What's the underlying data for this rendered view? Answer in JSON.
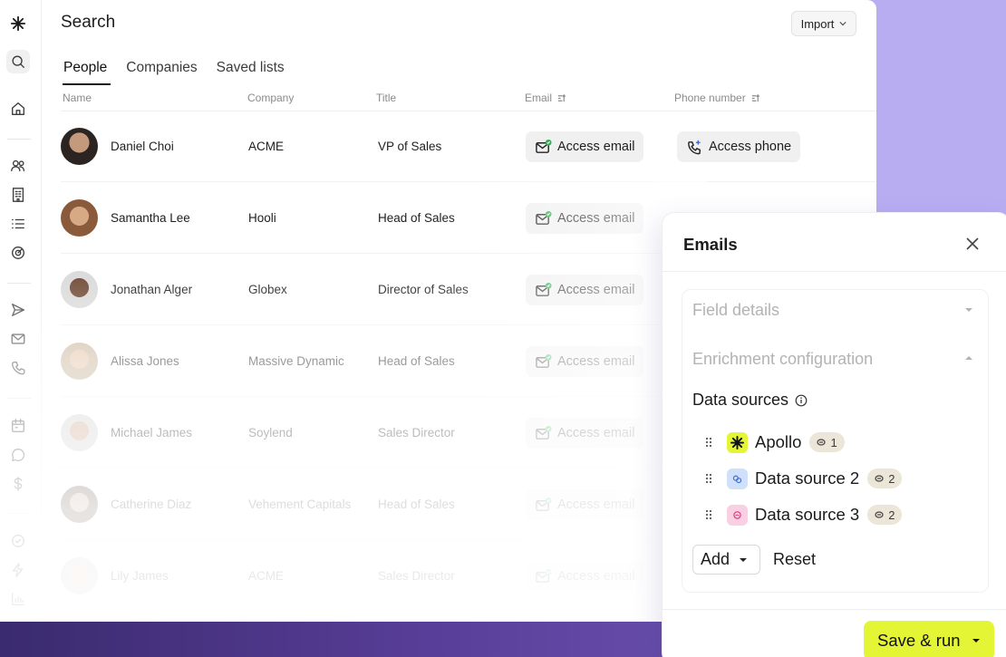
{
  "header": {
    "title": "Search",
    "import_label": "Import"
  },
  "tabs": [
    {
      "label": "People",
      "active": true
    },
    {
      "label": "Companies",
      "active": false
    },
    {
      "label": "Saved lists",
      "active": false
    }
  ],
  "columns": {
    "name": "Name",
    "company": "Company",
    "title": "Title",
    "email": "Email",
    "phone": "Phone number"
  },
  "rows": [
    {
      "name": "Daniel Choi",
      "company": "ACME",
      "title": "VP of Sales",
      "email_label": "Access email",
      "phone_label": "Access phone"
    },
    {
      "name": "Samantha Lee",
      "company": "Hooli",
      "title": "Head of Sales",
      "email_label": "Access email"
    },
    {
      "name": "Jonathan Alger",
      "company": "Globex",
      "title": "Director of Sales",
      "email_label": "Access email"
    },
    {
      "name": "Alissa Jones",
      "company": "Massive Dynamic",
      "title": "Head of Sales",
      "email_label": "Access email"
    },
    {
      "name": "Michael James",
      "company": "Soylend",
      "title": "Sales Director",
      "email_label": "Access email"
    },
    {
      "name": "Catherine Diaz",
      "company": "Vehement Capitals",
      "title": "Head of Sales",
      "email_label": "Access email"
    },
    {
      "name": "Lily James",
      "company": "ACME",
      "title": "Sales Director",
      "email_label": "Access email"
    }
  ],
  "sidebar": {
    "icons": [
      "logo-icon",
      "search-icon",
      "home-icon",
      "people-icon",
      "building-icon",
      "list-icon",
      "radar-icon",
      "send-icon",
      "mail-icon",
      "phone-icon",
      "calendar-icon",
      "chat-icon",
      "dollar-icon",
      "check-circle-icon",
      "bolt-icon",
      "chart-icon"
    ]
  },
  "panel": {
    "title": "Emails",
    "field_details": "Field details",
    "enrichment_configuration": "Enrichment configuration",
    "data_sources_title": "Data sources",
    "sources": [
      {
        "label": "Apollo",
        "count": "1",
        "icon_color": "#e3f535"
      },
      {
        "label": "Data source 2",
        "count": "2",
        "icon_color": "#cfe0fb"
      },
      {
        "label": "Data source 3",
        "count": "2",
        "icon_color": "#f9cfe3"
      }
    ],
    "add_label": "Add",
    "reset_label": "Reset",
    "save_label": "Save & run"
  },
  "colors": {
    "accent": "#e3f535",
    "background": "#b9adf2",
    "email_check": "#2bb24c"
  }
}
